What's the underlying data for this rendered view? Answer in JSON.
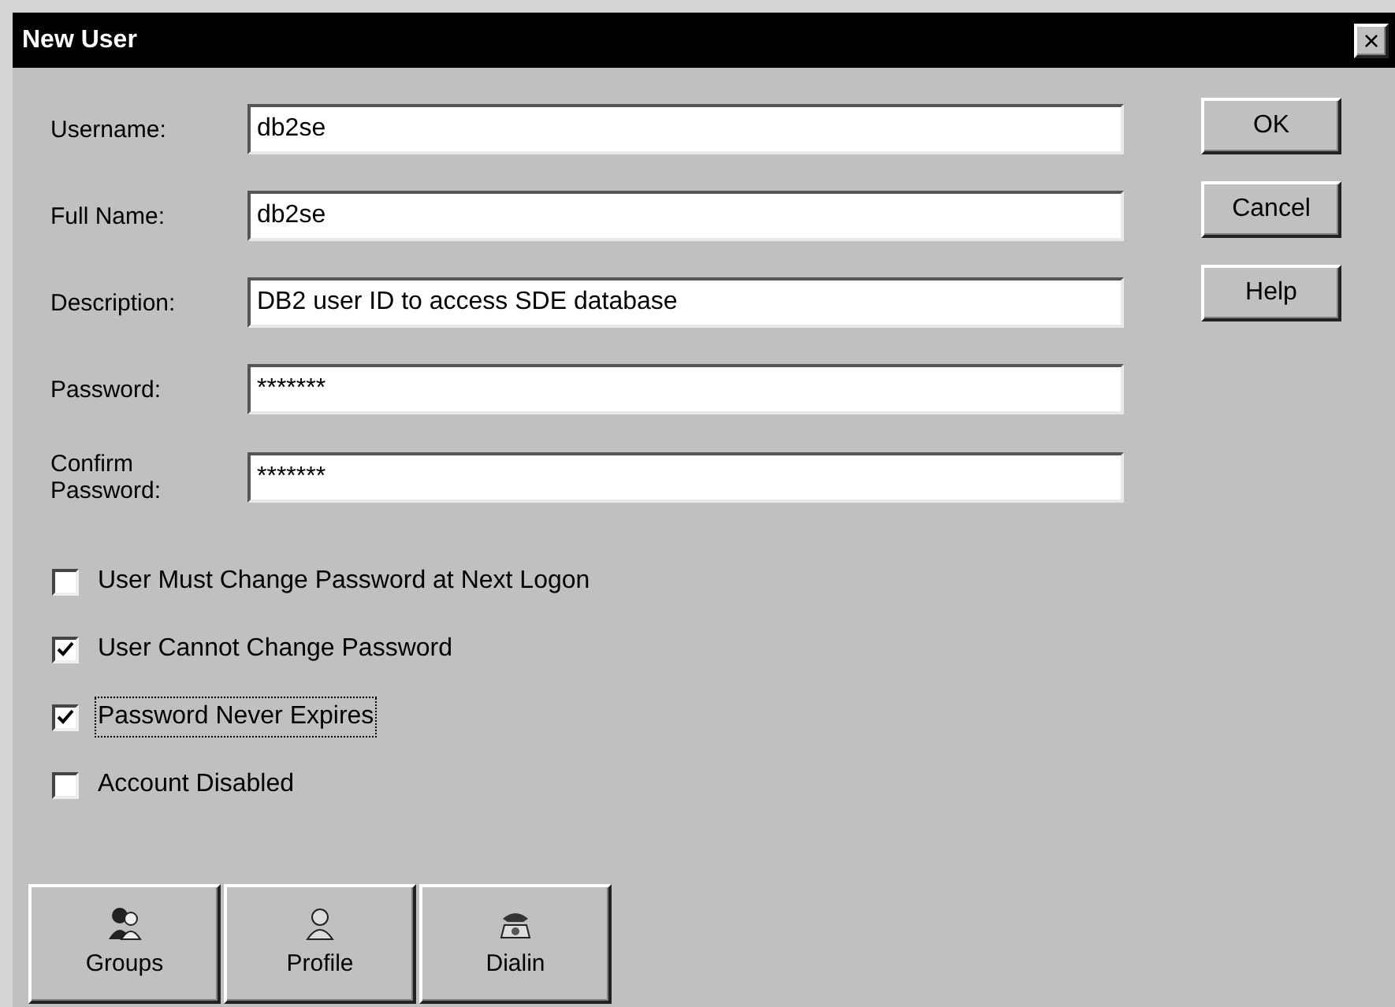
{
  "window": {
    "title": "New User",
    "close": "×"
  },
  "fields": [
    {
      "label": "Username:",
      "value": "db2se"
    },
    {
      "label": "Full Name:",
      "value": "db2se"
    },
    {
      "label": "Description:",
      "value": "DB2 user ID to access SDE database"
    },
    {
      "label": "Password:",
      "value": "*******"
    },
    {
      "label": "Confirm Password:",
      "value": "*******"
    }
  ],
  "checkboxes": [
    {
      "label": "User Must Change Password at Next Logon",
      "checked": false,
      "focused": false
    },
    {
      "label": "User Cannot Change Password",
      "checked": true,
      "focused": false
    },
    {
      "label": "Password Never Expires",
      "checked": true,
      "focused": true
    },
    {
      "label": "Account Disabled",
      "checked": false,
      "focused": false
    }
  ],
  "buttons": [
    "OK",
    "Cancel",
    "Help"
  ],
  "bottom_buttons": [
    {
      "label": "Groups",
      "kind": "groups"
    },
    {
      "label": "Profile",
      "kind": "profile"
    },
    {
      "label": "Dialin",
      "kind": "dialin"
    }
  ]
}
